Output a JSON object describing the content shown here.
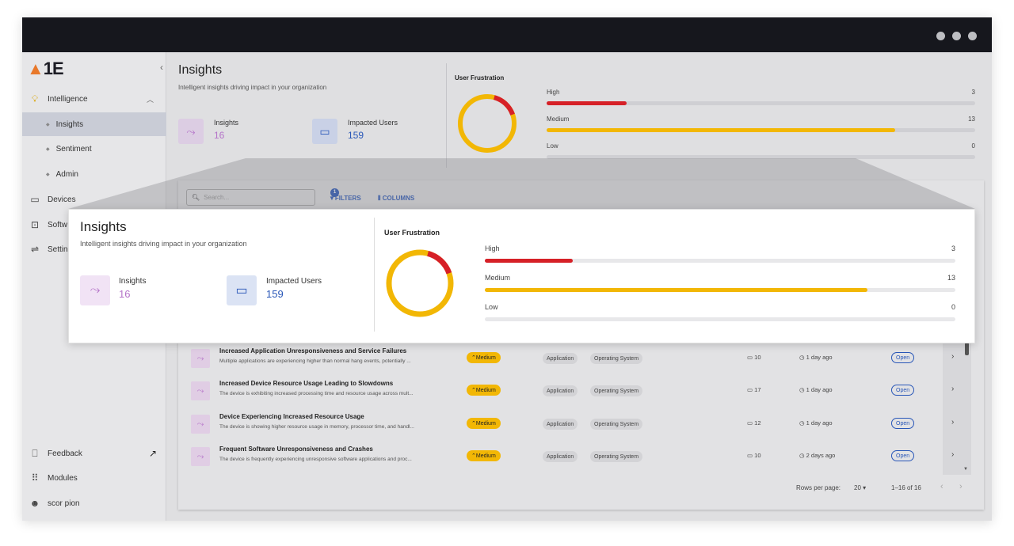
{
  "sidebar": {
    "logo": "1E",
    "items": [
      {
        "label": "Intelligence",
        "icon": "bulb-icon"
      },
      {
        "label": "Insights",
        "icon": "bullet-icon"
      },
      {
        "label": "Sentiment",
        "icon": "bullet-icon"
      },
      {
        "label": "Admin",
        "icon": "bullet-icon"
      },
      {
        "label": "Devices",
        "icon": "monitor-icon"
      },
      {
        "label": "Softw",
        "icon": "terminal-icon"
      },
      {
        "label": "Settin",
        "icon": "sliders-icon"
      }
    ],
    "bottom": [
      {
        "label": "Feedback",
        "icon": "feedback-icon"
      },
      {
        "label": "Modules",
        "icon": "grid-icon"
      },
      {
        "label": "scor pion",
        "icon": "avatar-icon"
      }
    ]
  },
  "header": {
    "title": "Insights",
    "subtitle": "Intelligent insights driving impact in your organization",
    "kpis": [
      {
        "label": "Insights",
        "value": "16"
      },
      {
        "label": "Impacted Users",
        "value": "159"
      }
    ],
    "frustration": {
      "title": "User Frustration",
      "levels": [
        {
          "label": "High",
          "value": "3",
          "color": "#d62027"
        },
        {
          "label": "Medium",
          "value": "13",
          "color": "#f2b705"
        },
        {
          "label": "Low",
          "value": "0",
          "color": "#cfcfd3"
        }
      ]
    }
  },
  "toolbar": {
    "search_placeholder": "Search...",
    "filters_label": "FILTERS",
    "filters_count": "1",
    "columns_label": "COLUMNS"
  },
  "rows": [
    {
      "title": "Increased Application Unresponsiveness and Service Failures",
      "desc": "Multiple applications are experiencing higher than normal hang events, potentially ...",
      "severity": "Medium",
      "tags": [
        "Application",
        "Operating System"
      ],
      "count": "10",
      "when": "1 day ago",
      "status": "Open"
    },
    {
      "title": "Increased Device Resource Usage Leading to Slowdowns",
      "desc": "The device is exhibiting increased processing time and resource usage across mult...",
      "severity": "Medium",
      "tags": [
        "Application",
        "Operating System"
      ],
      "count": "17",
      "when": "1 day ago",
      "status": "Open"
    },
    {
      "title": "Device Experiencing Increased Resource Usage",
      "desc": "The device is showing higher resource usage in memory, processor time, and handl...",
      "severity": "Medium",
      "tags": [
        "Application",
        "Operating System"
      ],
      "count": "12",
      "when": "1 day ago",
      "status": "Open"
    },
    {
      "title": "Frequent Software Unresponsiveness and Crashes",
      "desc": "The device is frequently experiencing unresponsive software applications and proc...",
      "severity": "Medium",
      "tags": [
        "Application",
        "Operating System"
      ],
      "count": "10",
      "when": "2 days ago",
      "status": "Open"
    }
  ],
  "pager": {
    "rows_label": "Rows per page:",
    "rows_value": "20",
    "range": "1–16 of 16"
  },
  "colors": {
    "high": "#d62027",
    "medium": "#f2b705",
    "accent": "#2957b8",
    "insight_purple": "#b574c9"
  }
}
